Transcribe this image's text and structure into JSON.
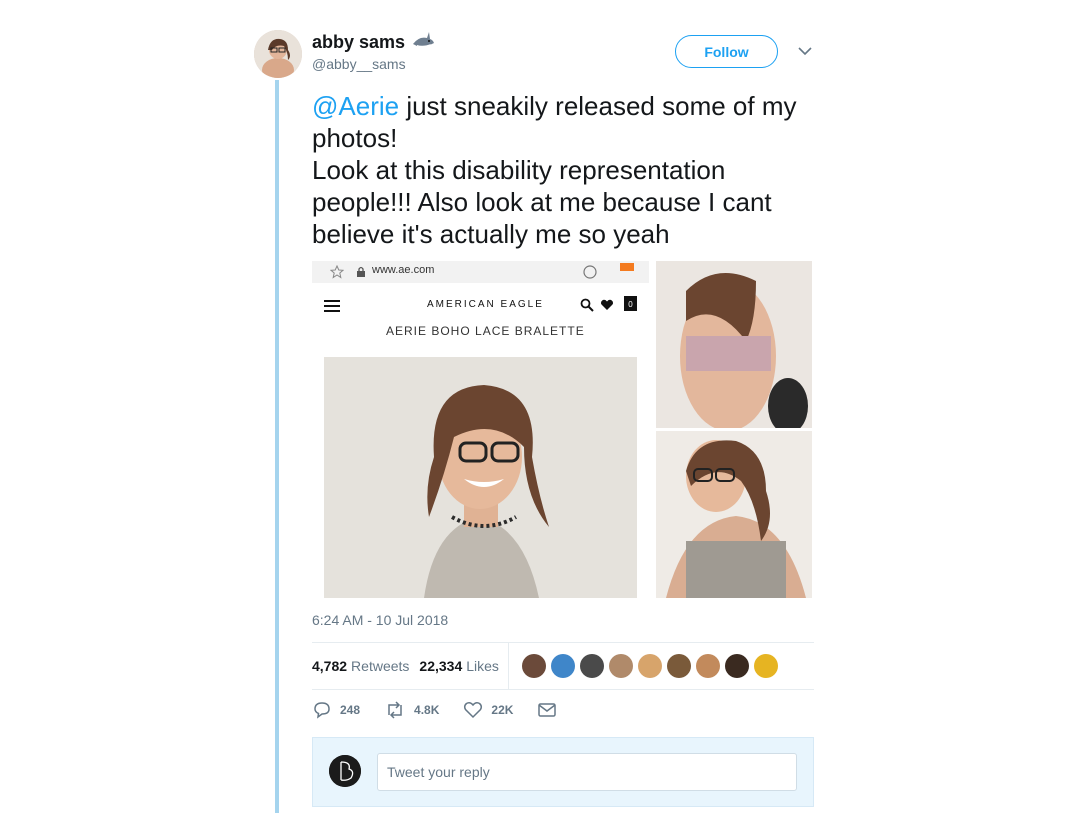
{
  "author": {
    "display_name": "abby sams",
    "handle": "@abby__sams",
    "badge_icon": "shark-emoji"
  },
  "header": {
    "follow_label": "Follow",
    "more_icon": "chevron-down-icon"
  },
  "tweet": {
    "mention": "@Aerie",
    "text_rest": " just sneakily released some of my photos!",
    "line2": "Look at this disability representation people!!! Also look at me because I cant believe it's actually me so yeah"
  },
  "media": {
    "url_text": "www.ae.com",
    "brand": "AMERICAN EAGLE",
    "product": "AERIE BOHO LACE BRALETTE",
    "bag_count": "0"
  },
  "timestamp": "6:24 AM - 10 Jul 2018",
  "stats": {
    "retweets_count": "4,782",
    "retweets_label": "Retweets",
    "likes_count": "22,334",
    "likes_label": "Likes"
  },
  "likers": [
    {
      "color": "#6b4a3a"
    },
    {
      "color": "#3f86c9"
    },
    {
      "color": "#4a4a4a"
    },
    {
      "color": "#b08a6a"
    },
    {
      "color": "#d7a46b"
    },
    {
      "color": "#7a5a3a"
    },
    {
      "color": "#c28a5c"
    },
    {
      "color": "#3a2a20"
    },
    {
      "color": "#e6b422"
    }
  ],
  "actions": {
    "replies": "248",
    "retweets": "4.8K",
    "likes": "22K"
  },
  "reply": {
    "placeholder": "Tweet your reply"
  },
  "colors": {
    "accent": "#1da1f2",
    "thread_line": "#a5d4ee",
    "muted": "#657786"
  }
}
